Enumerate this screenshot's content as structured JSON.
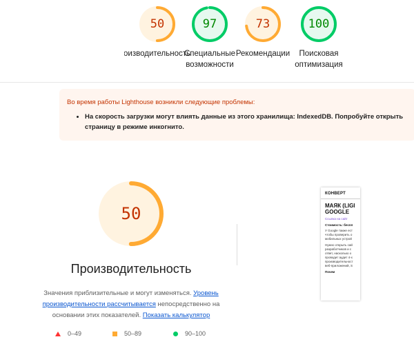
{
  "colors": {
    "poor": "#ff3333",
    "poor_text": "#c33300",
    "average": "#ffaa33",
    "average_text": "#c33300",
    "good": "#00cc66",
    "good_text": "#008800",
    "track_average": "#fff3e0",
    "track_good": "#e6f9ef"
  },
  "categories": [
    {
      "score": "50",
      "value": 50,
      "status": "average",
      "label_lines": [
        "Производительность"
      ]
    },
    {
      "score": "97",
      "value": 97,
      "status": "good",
      "label_lines": [
        "Специальные",
        "возможности"
      ]
    },
    {
      "score": "73",
      "value": 73,
      "status": "average",
      "label_lines": [
        "Рекомендации"
      ]
    },
    {
      "score": "100",
      "value": 100,
      "status": "good",
      "label_lines": [
        "Поисковая",
        "оптимизация"
      ]
    }
  ],
  "warning": {
    "title": "Во время работы Lighthouse возникли следующие проблемы:",
    "items": [
      "На скорость загрузки могут влиять данные из этого хранилища: IndexedDB. Попробуйте открыть страницу в режиме инкогнито."
    ]
  },
  "performance": {
    "score": "50",
    "value": 50,
    "title": "Производительность",
    "desc_text_1": "Значения приблизительные и могут изменяться. ",
    "desc_link_1": "Уровень производительности рассчитывается",
    "desc_text_2": " непосредственно на основании этих показателей. ",
    "desc_link_2": "Показать калькулятор"
  },
  "legend": [
    {
      "icon": "triangle-icon",
      "range": "0–49"
    },
    {
      "icon": "square-icon",
      "range": "50–89"
    },
    {
      "icon": "circle-icon",
      "range": "90–100"
    }
  ],
  "screenshot": {
    "brand": "КОНВЕРТ",
    "headline_1": "МАЯК (LIGI",
    "headline_2": "GOOGLE",
    "link": "Ссылка на сайт",
    "cost": "Стоимость: беспл",
    "para_1": [
      "У Google также ест",
      "чтобы проверить о",
      "мобильных устрой"
    ],
    "para_2": [
      "Нужно открыть сай",
      "разработчиков и с",
      "ответ, насколько о",
      "проводит аудит 4-х",
      "производительност",
      "веб-приложений, S"
    ],
    "more": "Почем"
  }
}
